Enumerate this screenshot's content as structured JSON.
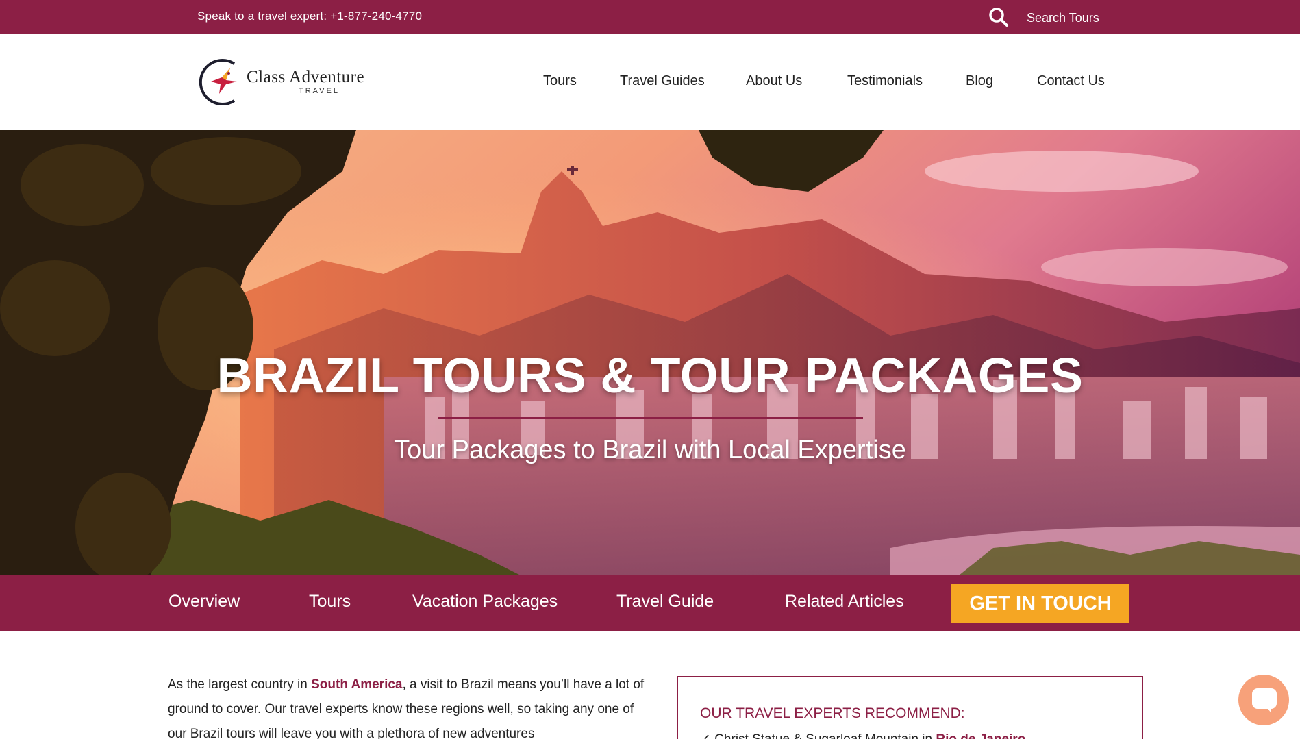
{
  "topbar": {
    "phone": "Speak to a travel expert: +1-877-240-4770",
    "search_label": "Search Tours"
  },
  "logo": {
    "name": "Class Adventure",
    "tagline": "TRAVEL"
  },
  "nav": {
    "items": [
      "Tours",
      "Travel Guides",
      "About Us",
      "Testimonials",
      "Blog",
      "Contact Us"
    ]
  },
  "hero": {
    "title": "BRAZIL TOURS & TOUR PACKAGES",
    "subtitle": "Tour Packages to Brazil with Local Expertise"
  },
  "section_nav": {
    "items": [
      "Overview",
      "Tours",
      "Vacation Packages",
      "Travel Guide",
      "Related Articles"
    ],
    "cta": "GET IN TOUCH"
  },
  "intro": {
    "before_link": "As the largest country in ",
    "link": "South America",
    "after_link": ", a visit to Brazil means you’ll have a lot of ground to cover. Our travel experts know these regions well, so taking any one of our Brazil tours will leave you with a plethora of new adventures"
  },
  "recommend": {
    "title": "OUR TRAVEL EXPERTS RECOMMEND:",
    "item_text": "✓ Christ Statue & Sugarloaf Mountain in ",
    "item_link": "Rio de Janeiro"
  },
  "colors": {
    "brand": "#8c1f45",
    "cta": "#f5a623",
    "chat": "#f7a17a"
  }
}
